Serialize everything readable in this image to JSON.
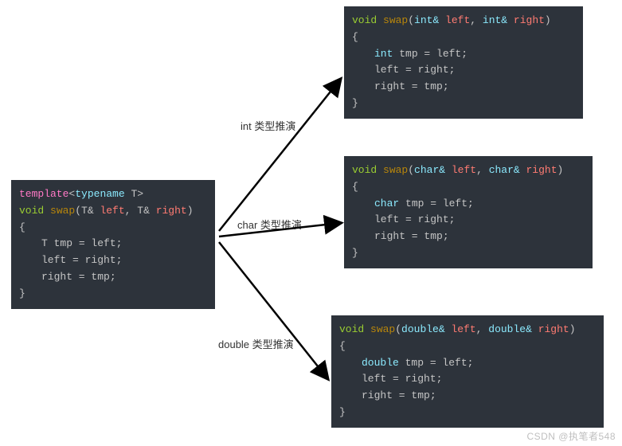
{
  "template_block": {
    "l1_template": "template",
    "l1_open": "<",
    "l1_typename": "typename",
    "l1_T": " T",
    "l1_close": ">",
    "l2_void": "void",
    "l2_fn": " swap",
    "l2_open": "(",
    "l2_type1": "T& ",
    "l2_p1": "left",
    "l2_comma": ", ",
    "l2_type2": "T& ",
    "l2_p2": "right",
    "l2_close": ")",
    "l3_brace_open": "{",
    "l4_type": "T ",
    "l4_body": "tmp = left;",
    "l5_body": "left = right;",
    "l6_body": "right = tmp;",
    "l7_brace_close": "}"
  },
  "labels": {
    "int": "int 类型推演",
    "char": "char 类型推演",
    "double": "double 类型推演"
  },
  "blocks": [
    {
      "type": "int",
      "l1_void": "void",
      "l1_fn": " swap",
      "l1_open": "(",
      "l1_t1": "int&",
      "l1_p1": " left",
      "l1_comma": ", ",
      "l1_t2": "int&",
      "l1_p2": " right",
      "l1_close": ")",
      "l2": "{",
      "l3_type": "int ",
      "l3_body": "tmp = left;",
      "l4_body": "left = right;",
      "l5_body": "right = tmp;",
      "l6": "}"
    },
    {
      "type": "char",
      "l1_void": "void",
      "l1_fn": " swap",
      "l1_open": "(",
      "l1_t1": "char&",
      "l1_p1": " left",
      "l1_comma": ", ",
      "l1_t2": "char&",
      "l1_p2": " right",
      "l1_close": ")",
      "l2": "{",
      "l3_type": "char ",
      "l3_body": "tmp = left;",
      "l4_body": "left = right;",
      "l5_body": "right = tmp;",
      "l6": "}"
    },
    {
      "type": "double",
      "l1_void": "void",
      "l1_fn": " swap",
      "l1_open": "(",
      "l1_t1": "double&",
      "l1_p1": " left",
      "l1_comma": ", ",
      "l1_t2": "double&",
      "l1_p2": " right",
      "l1_close": ")",
      "l2": "{",
      "l3_type": "double ",
      "l3_body": "tmp = left;",
      "l4_body": "left = right;",
      "l5_body": "right = tmp;",
      "l6": "}"
    }
  ],
  "watermark": "CSDN @执笔者548"
}
